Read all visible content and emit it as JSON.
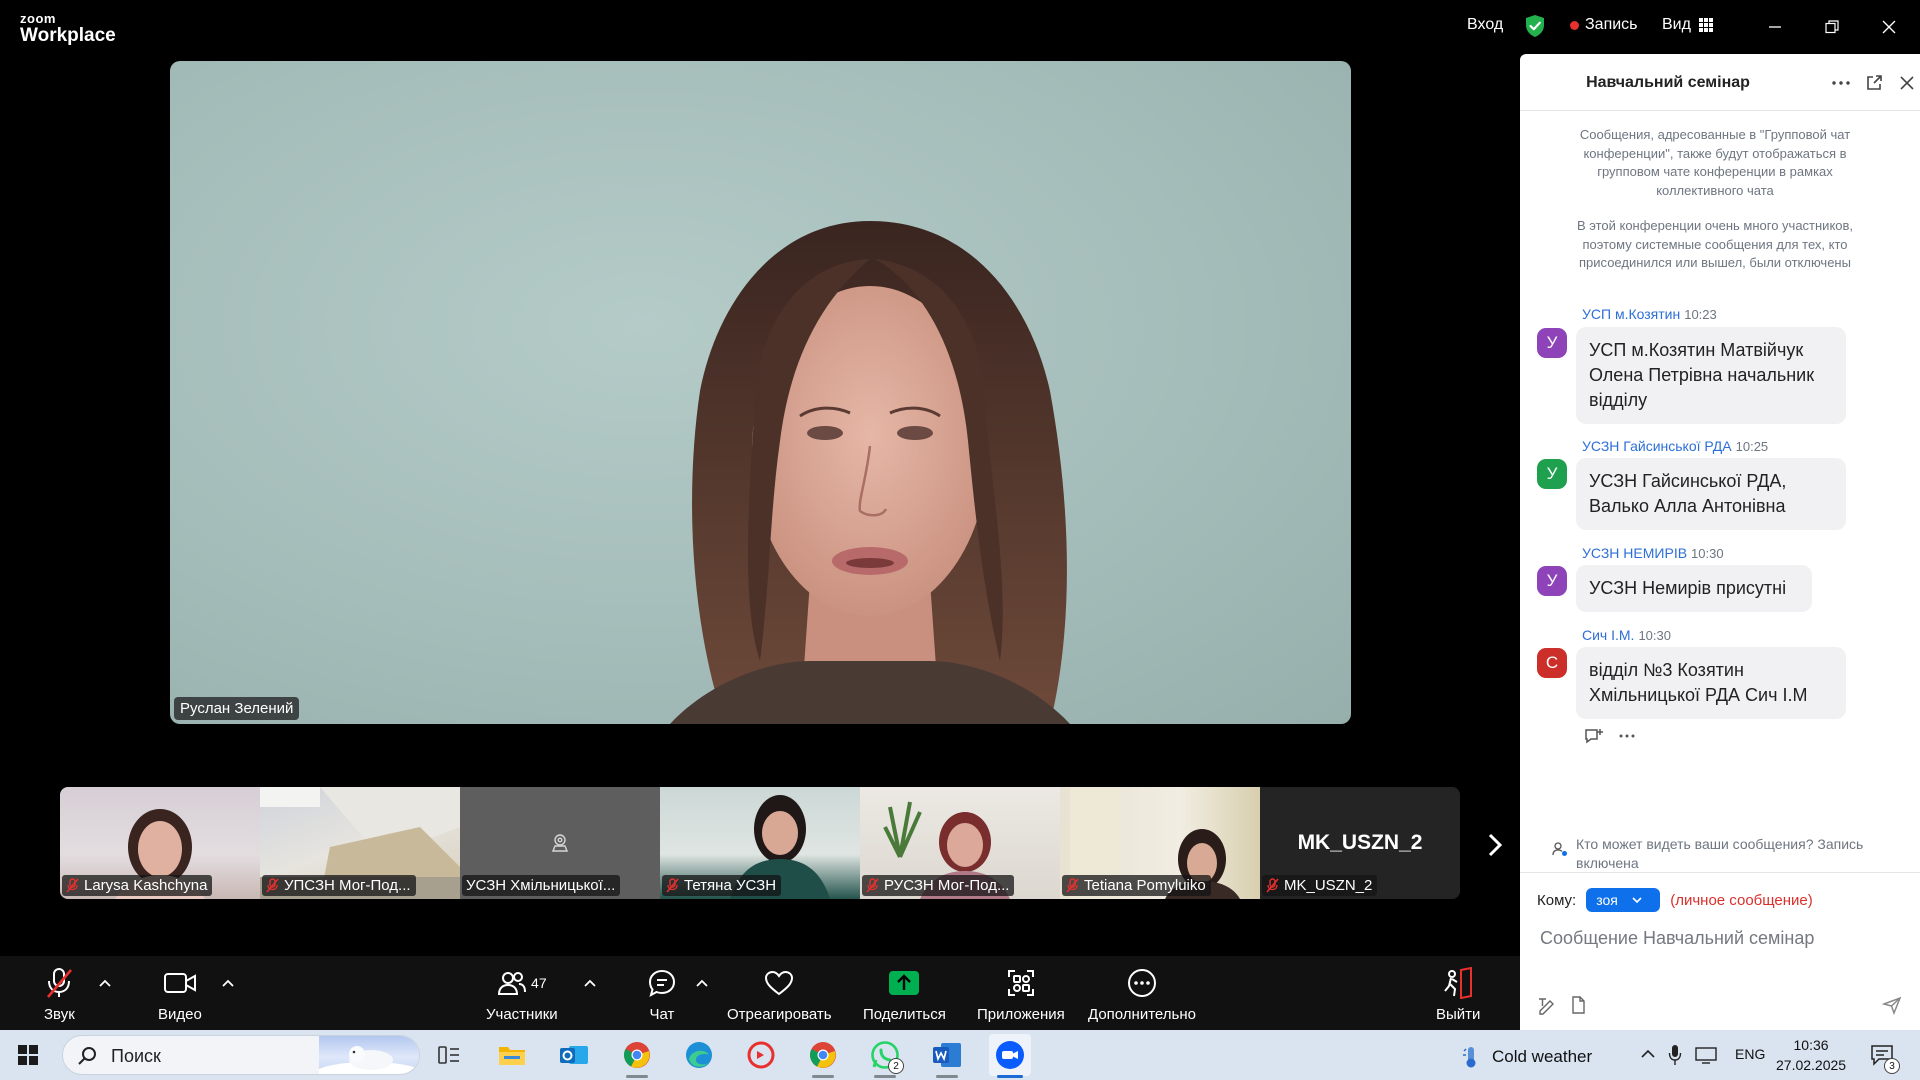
{
  "app": {
    "brand_small": "zoom",
    "brand_large": "Workplace"
  },
  "titlebar": {
    "login": "Вход",
    "record": "Запись",
    "view": "Вид"
  },
  "main_video": {
    "speaker_name": "Руслан Зелений"
  },
  "thumbnails": [
    {
      "name": "Larysa Kashchyna",
      "mic_muted": true
    },
    {
      "name": "УПСЗН Мог-Под...",
      "mic_muted": true
    },
    {
      "name": "УСЗН Хмільницької...",
      "mic_muted": false
    },
    {
      "name": "Тетяна УСЗН",
      "mic_muted": true
    },
    {
      "name": "РУСЗН Мог-Под...",
      "mic_muted": true
    },
    {
      "name": "Tetiana Pomyluiko",
      "mic_muted": true
    },
    {
      "name": "MK_USZN_2",
      "mic_muted": true,
      "big_name": "MK_USZN_2"
    }
  ],
  "toolbar": {
    "audio": "Звук",
    "video": "Видео",
    "participants": "Участники",
    "participants_count": "47",
    "chat": "Чат",
    "react": "Отреагировать",
    "share": "Поделиться",
    "apps": "Приложения",
    "more": "Дополнительно",
    "leave": "Выйти"
  },
  "chat": {
    "title": "Навчальний семінар",
    "system_1": "Сообщения, адресованные в \"Групповой чат конференции\", также будут отображаться в групповом чате конференции в рамках коллективного чата",
    "system_2": "В этой конференции очень много участников, поэтому системные сообщения для тех, кто присоединился или вышел, были отключены",
    "messages": [
      {
        "sender": "УСП м.Козятин",
        "time": "10:23",
        "initial": "У",
        "color": "#8e44b8",
        "text": "УСП м.Козятин Матвійчук Олена Петрівна начальник відділу"
      },
      {
        "sender": "УСЗН Гайсинської РДА",
        "time": "10:25",
        "initial": "У",
        "color": "#1ea04f",
        "text": "УСЗН Гайсинської РДА, Валько Алла Антонівна"
      },
      {
        "sender": "УСЗН НЕМИРІВ",
        "time": "10:30",
        "initial": "У",
        "color": "#8e44b8",
        "text": "УСЗН Немирів присутні"
      },
      {
        "sender": "Сич І.М.",
        "time": "10:30",
        "initial": "С",
        "color": "#cc2e2a",
        "text": "відділ №3 Козятин Хмільницької РДА Сич І.М"
      }
    ],
    "privacy_note": "Кто может видеть ваши сообщения? Запись включена",
    "to_label": "Кому:",
    "to_value": "зоя",
    "private_note": "(личное сообщение)",
    "compose_placeholder": "Сообщение Навчальний семінар"
  },
  "taskbar": {
    "search": "Поиск",
    "whatsapp_badge": "2",
    "weather": "Cold weather",
    "lang": "ENG",
    "time": "10:36",
    "date": "27.02.2025",
    "notif_badge": "3"
  },
  "colors": {
    "accent": "#0e71eb",
    "record_dot": "#e8302f",
    "share_green": "#00b050",
    "link_blue": "#2d6fd8"
  }
}
